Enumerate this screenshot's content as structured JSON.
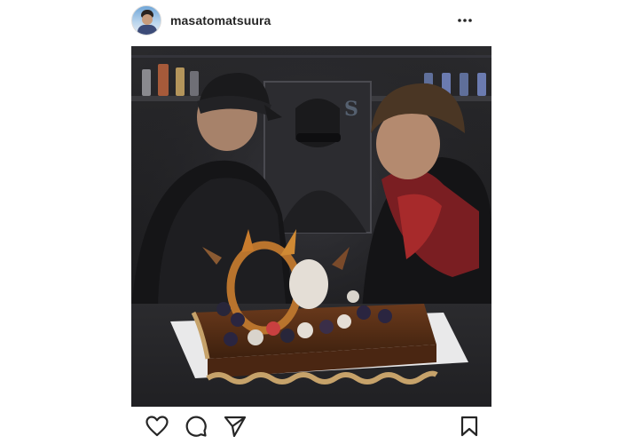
{
  "post": {
    "username": "masatomatsuura",
    "avatar": "avatar",
    "more_icon": "more-horizontal-icon",
    "photo_subject": "photo",
    "actions": {
      "like_icon": "heart-icon",
      "comment_icon": "comment-icon",
      "share_icon": "paper-plane-icon",
      "save_icon": "bookmark-icon"
    }
  },
  "colors": {
    "text": "#262626",
    "background": "#ffffff",
    "divider": "#dbdbdb"
  }
}
